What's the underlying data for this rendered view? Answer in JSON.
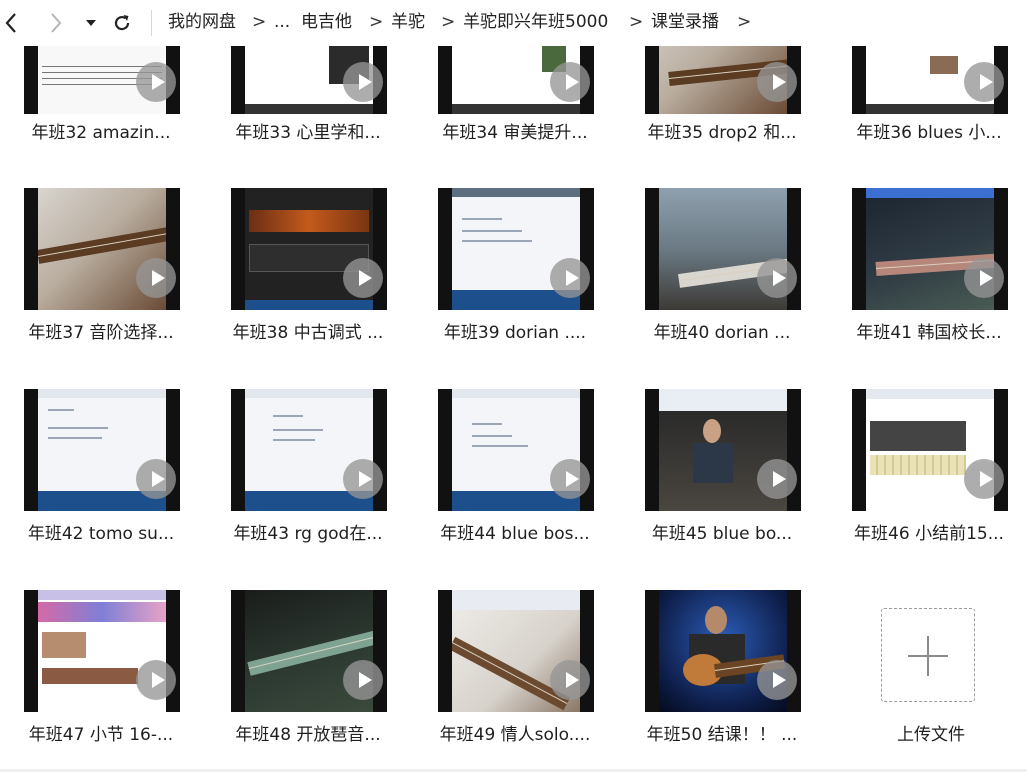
{
  "breadcrumb": {
    "items": [
      "我的网盘",
      "...",
      "电吉他",
      "羊驼",
      "羊驼即兴年班5000",
      "课堂录播"
    ],
    "separator": ">"
  },
  "files": [
    "年班32  amazin...",
    "年班33 心里学和...",
    "年班34 审美提升...",
    "年班35 drop2 和...",
    "年班36 blues 小...",
    "年班37 音阶选择...",
    "年班38 中古调式 ...",
    "年班39 dorian ....",
    "年班40  dorian ...",
    "年班41 韩国校长...",
    "年班42 tomo  su...",
    "年班43 rg god在...",
    "年班44 blue bos...",
    "年班45  blue bo...",
    "年班46 小结前15...",
    "年班47 小节 16-...",
    "年班48 开放琶音...",
    "年班49 情人solo....",
    "年班50 结课！！ ..."
  ],
  "upload_label": "上传文件",
  "icons": {
    "back": "chevron-left-icon",
    "forward": "chevron-right-icon",
    "history": "caret-down-icon",
    "refresh": "refresh-icon",
    "play": "play-icon",
    "upload": "plus-icon"
  },
  "colors": {
    "play_overlay": "#969696",
    "thumb_frame": "#111111",
    "text": "#1f1f1f"
  }
}
